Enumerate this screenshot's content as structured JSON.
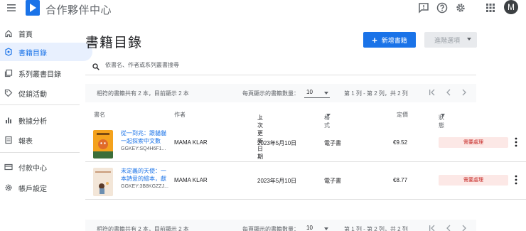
{
  "app": {
    "title": "合作夥伴中心",
    "avatar_initial": "M",
    "brand_color": "#1a73e8"
  },
  "top_icons": [
    "feedback-icon",
    "help-icon",
    "settings-gear-icon",
    "apps-grid-icon"
  ],
  "sidebar": {
    "items": [
      {
        "label": "首頁",
        "icon": "home-icon"
      },
      {
        "label": "書籍目錄",
        "icon": "book-catalog-icon",
        "active": true
      },
      {
        "label": "系列叢書目錄",
        "icon": "series-icon"
      },
      {
        "label": "促銷活動",
        "icon": "tag-icon"
      },
      {
        "label": "數據分析",
        "icon": "bar-chart-icon"
      },
      {
        "label": "報表",
        "icon": "report-icon"
      },
      {
        "label": "付款中心",
        "icon": "payment-icon"
      },
      {
        "label": "帳戶設定",
        "icon": "gear-icon"
      }
    ]
  },
  "main": {
    "title": "書籍目錄",
    "new_button": "新增書籍",
    "advanced_button": "進階選項",
    "search_placeholder": "依書名、作者或系列叢書搜尋",
    "pager": {
      "count_text": "相符的書籍共有 2 本，目前顯示 2 本",
      "per_page_label": "每頁顯示的書籍數量：",
      "per_page_value": "10",
      "range_text": "第 1 列 - 第 2 列，共 2 列"
    },
    "columns": {
      "title": "書名",
      "author": "作者",
      "updated": "上次更新日期",
      "format": "格式",
      "price": "定價",
      "status": "狀態"
    },
    "rows": [
      {
        "title": "從一到兆：跟貓貓一起探索中文數",
        "ggkey": "GGKEY:SQ4H6F1...",
        "author": "MAMA KLAR",
        "updated": "2023年5月10日",
        "format": "電子書",
        "price": "€9.52",
        "status": "需要處理",
        "cover_color": "#f4a21d"
      },
      {
        "title": "未定義的天使：一本詩意的繪本，獻",
        "ggkey": "GGKEY:3B8KGZZJ...",
        "author": "MAMA KLAR",
        "updated": "2023年5月10日",
        "format": "電子書",
        "price": "€8.77",
        "status": "需要處理",
        "cover_color": "#f3e6d8"
      }
    ]
  }
}
